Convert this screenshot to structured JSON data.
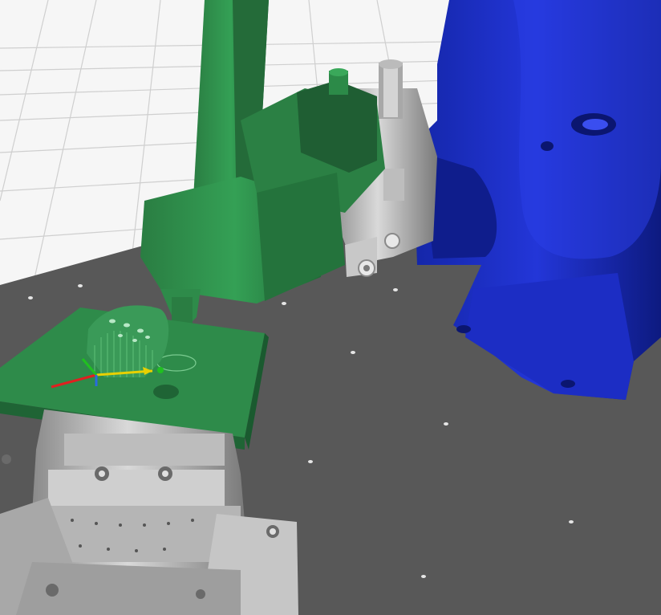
{
  "viewport": {
    "background_color": "#f4f4f4",
    "grid_color": "#c8c8c8",
    "table_color": "#585858",
    "robot_arm_color": "#1a2ad0",
    "tool_color": "#2e8b4a",
    "fixture_color": "#c4c4c4"
  },
  "axes_gizmo": {
    "x_axis_color": "#e02020",
    "y_axis_color": "#e8d000",
    "z_axis_color": "#2a6ae0",
    "green_axis_color": "#20c020"
  }
}
